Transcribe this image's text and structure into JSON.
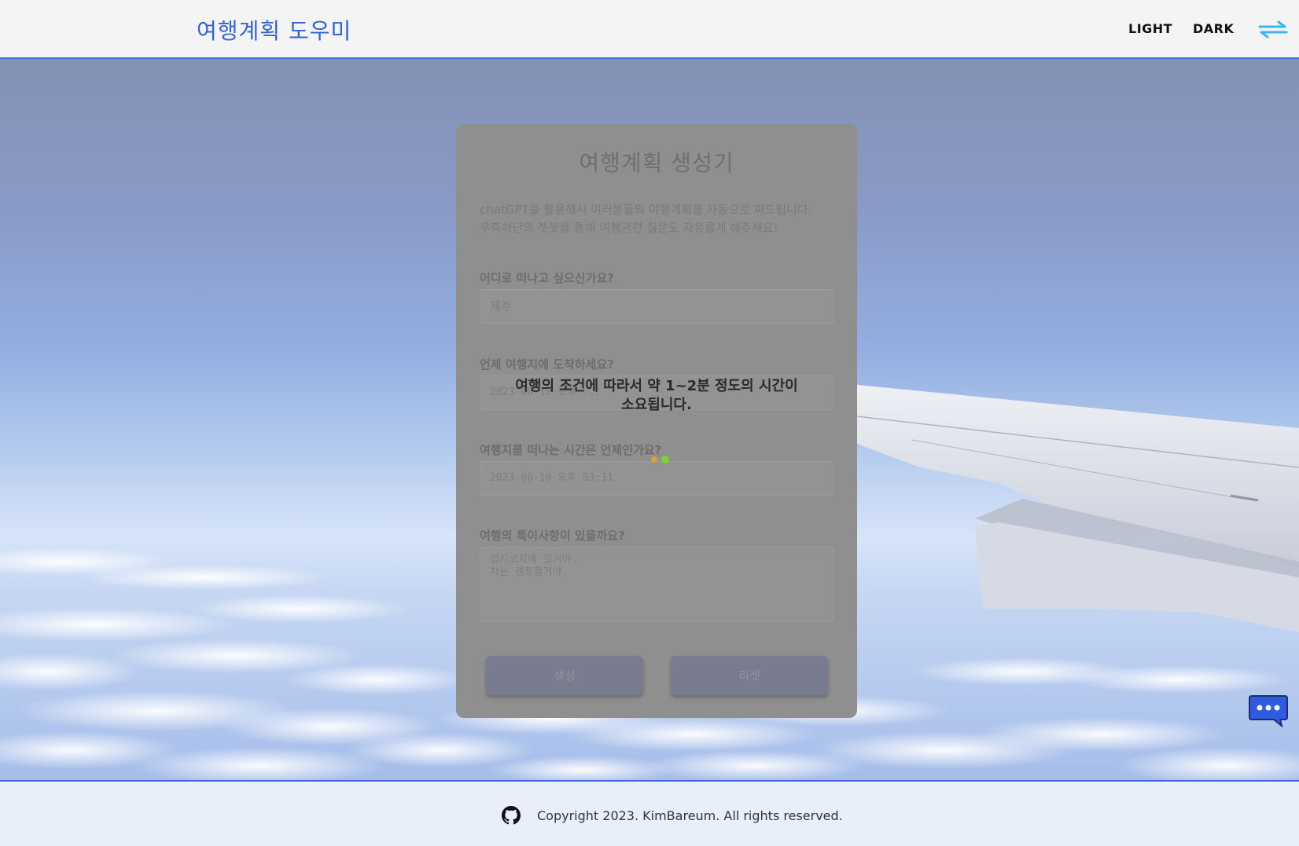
{
  "header": {
    "logo": "여행계획 도우미",
    "nav_light": "LIGHT",
    "nav_dark": "DARK",
    "menu_icon": "double-arrow-menu-icon"
  },
  "card": {
    "title": "여행계획 생성기",
    "desc_line1": "chatGPT를 활용해서 여러분들의 여행계획을 자동으로 짜드립니다.",
    "desc_line2": "우측하단의 챗봇을 통해 여행관련 질문도 자유롭게 해주세요!",
    "q_destination": "어디로 떠나고 싶으신가요?",
    "destination_value": "제주",
    "q_arrival": "언제 여행지에 도착하세요?",
    "arrival_value": "2023-06-10 오후 ...",
    "q_departure": "여행지를 떠나는 시간은 언제인가요?",
    "departure_value": "2023-06-10 오후 03:11",
    "q_notes": "여행의 특이사항이 있을까요?",
    "notes_value": "섭지코지에 갈거야.\n차는 렌트할거야.",
    "btn_generate": "생성",
    "btn_reset": "리셋"
  },
  "loading": {
    "line1": "여행의 조건에 따라서 약 1~2분 정도의 시간이",
    "line2": "소요됩니다.",
    "dot_colors": [
      "#d6a23a",
      "#7fd32c"
    ]
  },
  "chatbot": {
    "icon": "chat-bubble-icon"
  },
  "footer": {
    "github_icon": "github-icon",
    "copyright": "Copyright 2023. KimBareum. All rights reserved."
  },
  "colors": {
    "accent": "#2f64d8",
    "border_blue": "#3d66d8",
    "chatbot": "#2f5be0"
  }
}
